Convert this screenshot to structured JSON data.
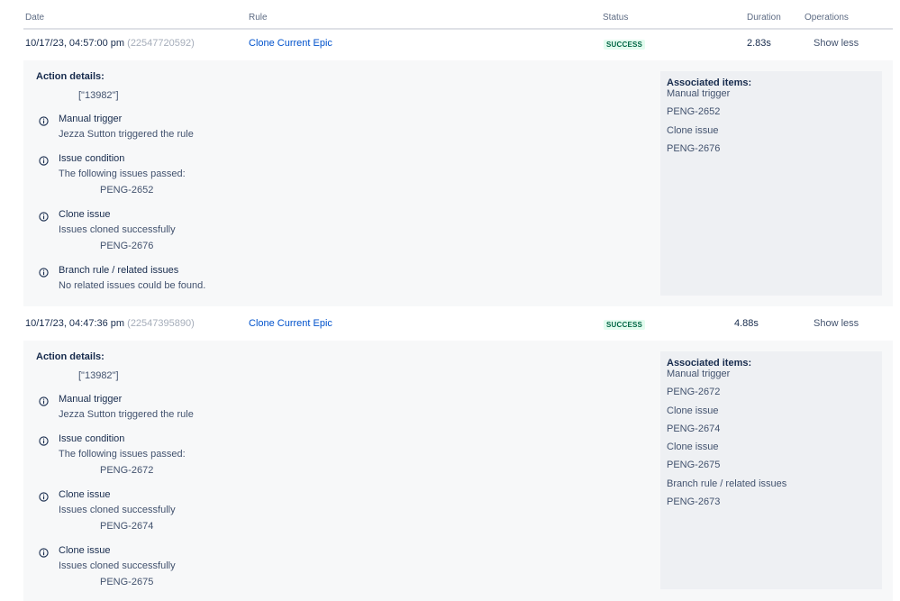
{
  "table": {
    "headers": {
      "date": "Date",
      "rule": "Rule",
      "status": "Status",
      "duration": "Duration",
      "operations": "Operations"
    }
  },
  "rows": [
    {
      "date": "10/17/23, 04:57:00 pm",
      "id": "(22547720592)",
      "rule": "Clone Current Epic",
      "status": "SUCCESS",
      "duration": "2.83s",
      "operation": "Show less",
      "action_details_label": "Action details:",
      "action_details_value": "[\"13982\"]",
      "steps": [
        {
          "title": "Manual trigger",
          "line": "Jezza Sutton triggered the rule"
        },
        {
          "title": "Issue condition",
          "line": "The following issues passed:",
          "issue": "PENG-2652"
        },
        {
          "title": "Clone issue",
          "line": "Issues cloned successfully",
          "issue": "PENG-2676"
        },
        {
          "title": "Branch rule / related issues",
          "line": "No related issues could be found."
        }
      ],
      "associated": {
        "label": "Associated items:",
        "items": [
          {
            "text": "Manual trigger",
            "kind": "plain"
          },
          {
            "text": "PENG-2652",
            "kind": "link"
          },
          {
            "text": "Clone issue",
            "kind": "plain"
          },
          {
            "text": "PENG-2676",
            "kind": "link"
          }
        ]
      }
    },
    {
      "date": "10/17/23, 04:47:36 pm",
      "id": "(22547395890)",
      "rule": "Clone Current Epic",
      "status": "SUCCESS",
      "duration": "4.88s",
      "operation": "Show less",
      "action_details_label": "Action details:",
      "action_details_value": "[\"13982\"]",
      "steps": [
        {
          "title": "Manual trigger",
          "line": "Jezza Sutton triggered the rule"
        },
        {
          "title": "Issue condition",
          "line": "The following issues passed:",
          "issue": "PENG-2672"
        },
        {
          "title": "Clone issue",
          "line": "Issues cloned successfully",
          "issue": "PENG-2674"
        },
        {
          "title": "Clone issue",
          "line": "Issues cloned successfully",
          "issue": "PENG-2675"
        }
      ],
      "associated": {
        "label": "Associated items:",
        "items": [
          {
            "text": "Manual trigger",
            "kind": "plain"
          },
          {
            "text": "PENG-2672",
            "kind": "link"
          },
          {
            "text": "Clone issue",
            "kind": "plain"
          },
          {
            "text": "PENG-2674",
            "kind": "link"
          },
          {
            "text": "Clone issue",
            "kind": "plain"
          },
          {
            "text": "PENG-2675",
            "kind": "link"
          },
          {
            "text": "Branch rule / related issues",
            "kind": "plain"
          },
          {
            "text": "PENG-2673",
            "kind": "link"
          }
        ]
      }
    }
  ],
  "icons": {
    "info": "info-circle-icon"
  },
  "colors": {
    "link": "#0052cc",
    "success_bg": "#e3fcef",
    "success_text": "#006644"
  }
}
